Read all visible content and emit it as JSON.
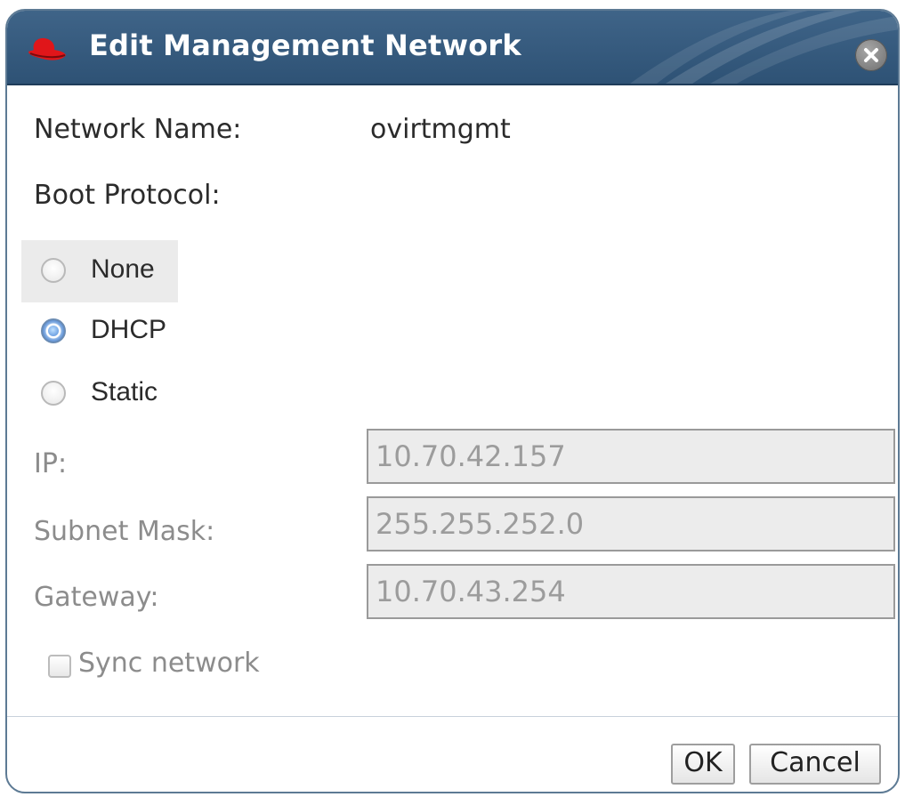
{
  "dialog": {
    "title": "Edit Management Network",
    "close_icon": "close-icon"
  },
  "form": {
    "network_name_label": "Network Name:",
    "network_name_value": "ovirtmgmt",
    "boot_protocol_label": "Boot Protocol:",
    "boot_options": [
      {
        "label": "None",
        "selected": false
      },
      {
        "label": "DHCP",
        "selected": true
      },
      {
        "label": "Static",
        "selected": false
      }
    ],
    "ip_label": "IP:",
    "ip_value": "10.70.42.157",
    "subnet_label": "Subnet Mask:",
    "subnet_value": "255.255.252.0",
    "gateway_label": "Gateway:",
    "gateway_value": "10.70.43.254",
    "sync_label": "Sync network",
    "sync_checked": false
  },
  "buttons": {
    "ok": "OK",
    "cancel": "Cancel"
  },
  "colors": {
    "titlebar": "#3a5f83",
    "title_text": "#ffffff",
    "disabled_text": "#8c8c8c",
    "radio_selected": "#3f78c8"
  }
}
